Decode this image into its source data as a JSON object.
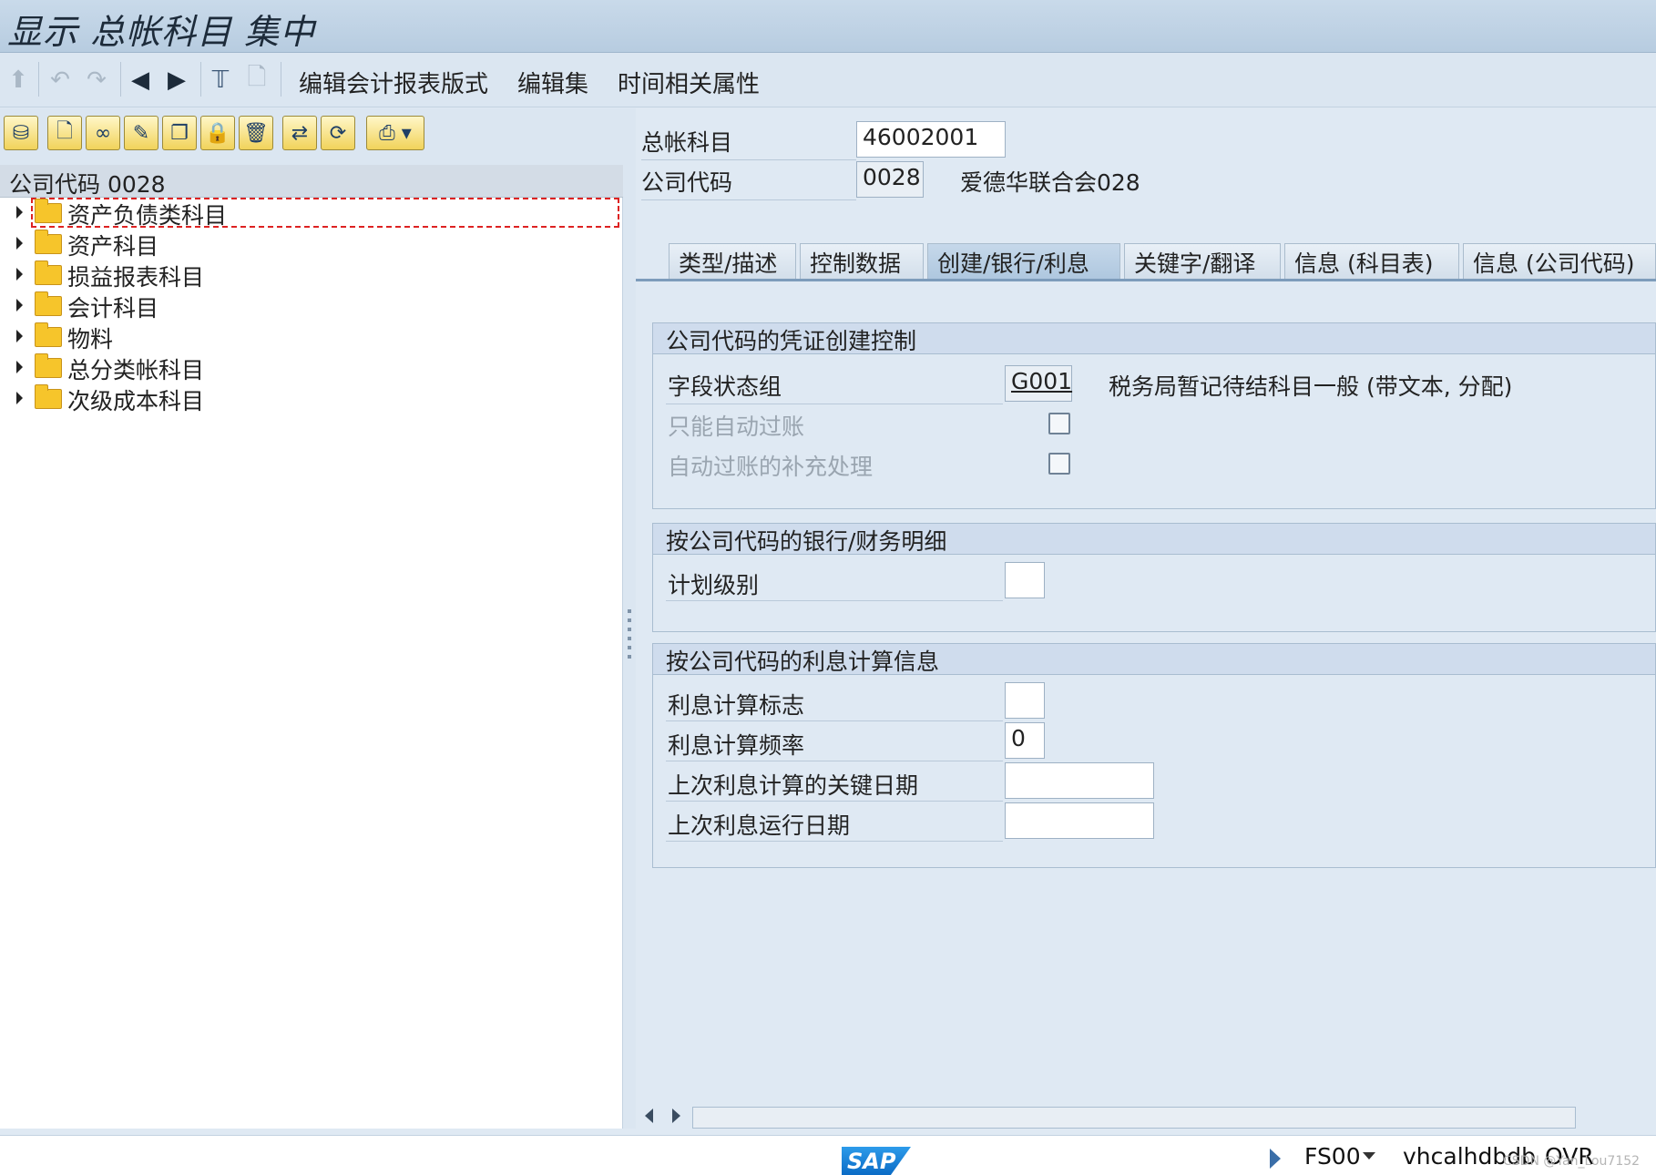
{
  "window": {
    "title": "显示 总帐科目 集中"
  },
  "app_toolbar": {
    "icons": [
      "share-icon",
      "undo-icon",
      "redo-icon",
      "previous-icon",
      "next-icon",
      "text-edit-icon",
      "document-search-icon"
    ],
    "menus": [
      "编辑会计报表版式",
      "编辑集",
      "时间相关属性"
    ]
  },
  "left_toolbar": {
    "buttons": [
      "binoculars-icon",
      "new-document-icon",
      "glasses-icon",
      "pencil-icon",
      "copy-icon",
      "lock-icon",
      "delete-icon",
      "transport-icon",
      "refresh-icon",
      "print-icon"
    ]
  },
  "tree": {
    "header": "公司代码 0028",
    "items": [
      "资产负债类科目",
      "资产科目",
      "损益报表科目",
      "会计科目",
      "物料",
      "总分类帐科目",
      "次级成本科目"
    ],
    "selected_index": 0
  },
  "header_fields": {
    "gl_account_label": "总帐科目",
    "gl_account_value": "46002001",
    "company_code_label": "公司代码",
    "company_code_value": "0028",
    "company_name": "爱德华联合会028"
  },
  "tabs": [
    "类型/描述",
    "控制数据",
    "创建/银行/利息",
    "关键字/翻译",
    "信息 (科目表)",
    "信息 (公司代码)"
  ],
  "active_tab": "创建/银行/利息",
  "groups": {
    "doc_control": {
      "title": "公司代码的凭证创建控制",
      "field_status_label": "字段状态组",
      "field_status_value": "G001",
      "field_status_desc": "税务局暂记待结科目一般 (带文本, 分配)",
      "auto_post_only_label": "只能自动过账",
      "auto_post_supplement_label": "自动过账的补充处理"
    },
    "bank": {
      "title": "按公司代码的银行/财务明细",
      "planning_level_label": "计划级别",
      "planning_level_value": ""
    },
    "interest": {
      "title": "按公司代码的利息计算信息",
      "indicator_label": "利息计算标志",
      "indicator_value": "",
      "frequency_label": "利息计算频率",
      "frequency_value": "0",
      "last_key_date_label": "上次利息计算的关键日期",
      "last_key_date_value": "",
      "last_run_label": "上次利息运行日期",
      "last_run_value": ""
    }
  },
  "status_bar": {
    "logo": "SAP",
    "transaction": "FS00",
    "server": "vhcalhdbdb",
    "mode": "OVR",
    "watermark": "CSDN @Yan_Lou7152"
  }
}
